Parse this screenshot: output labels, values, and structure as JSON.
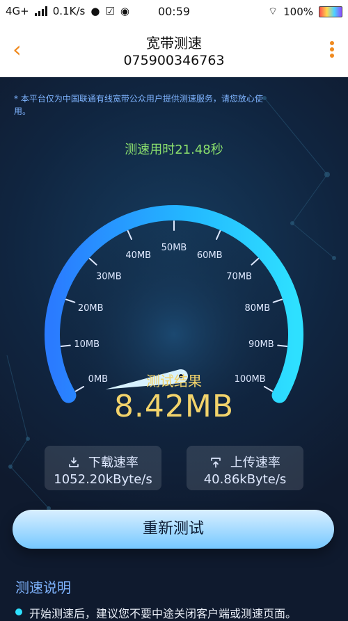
{
  "status": {
    "left_network": "4G+",
    "speed": "0.1K/s",
    "time": "00:59",
    "battery_text": "100%"
  },
  "header": {
    "title": "宽带测速",
    "subtitle": "075900346763"
  },
  "notice": "* 本平台仅为中国联通有线宽带公众用户提供测速服务，请您放心使用。",
  "test_time": "测速用时21.48秒",
  "gauge": {
    "ticks": [
      "0MB",
      "10MB",
      "20MB",
      "30MB",
      "40MB",
      "50MB",
      "60MB",
      "70MB",
      "80MB",
      "90MB",
      "100MB"
    ],
    "current_value_mb": 8.42,
    "max_value_mb": 100
  },
  "result": {
    "title": "测试结果",
    "value": "8.42MB"
  },
  "download": {
    "label": "下载速率",
    "value": "1052.20kByte/s"
  },
  "upload": {
    "label": "上传速率",
    "value": "40.86kByte/s"
  },
  "buttons": {
    "retest": "重新测试"
  },
  "section": {
    "title": "测速说明",
    "bullet_1": "开始测速后，建议您不要中途关闭客户端或测速页面。"
  },
  "colors": {
    "accent_orange": "#f08a1f",
    "gauge_cyan": "#2ee0ff",
    "result_yellow": "#f2d36b",
    "time_green": "#8be06d"
  }
}
